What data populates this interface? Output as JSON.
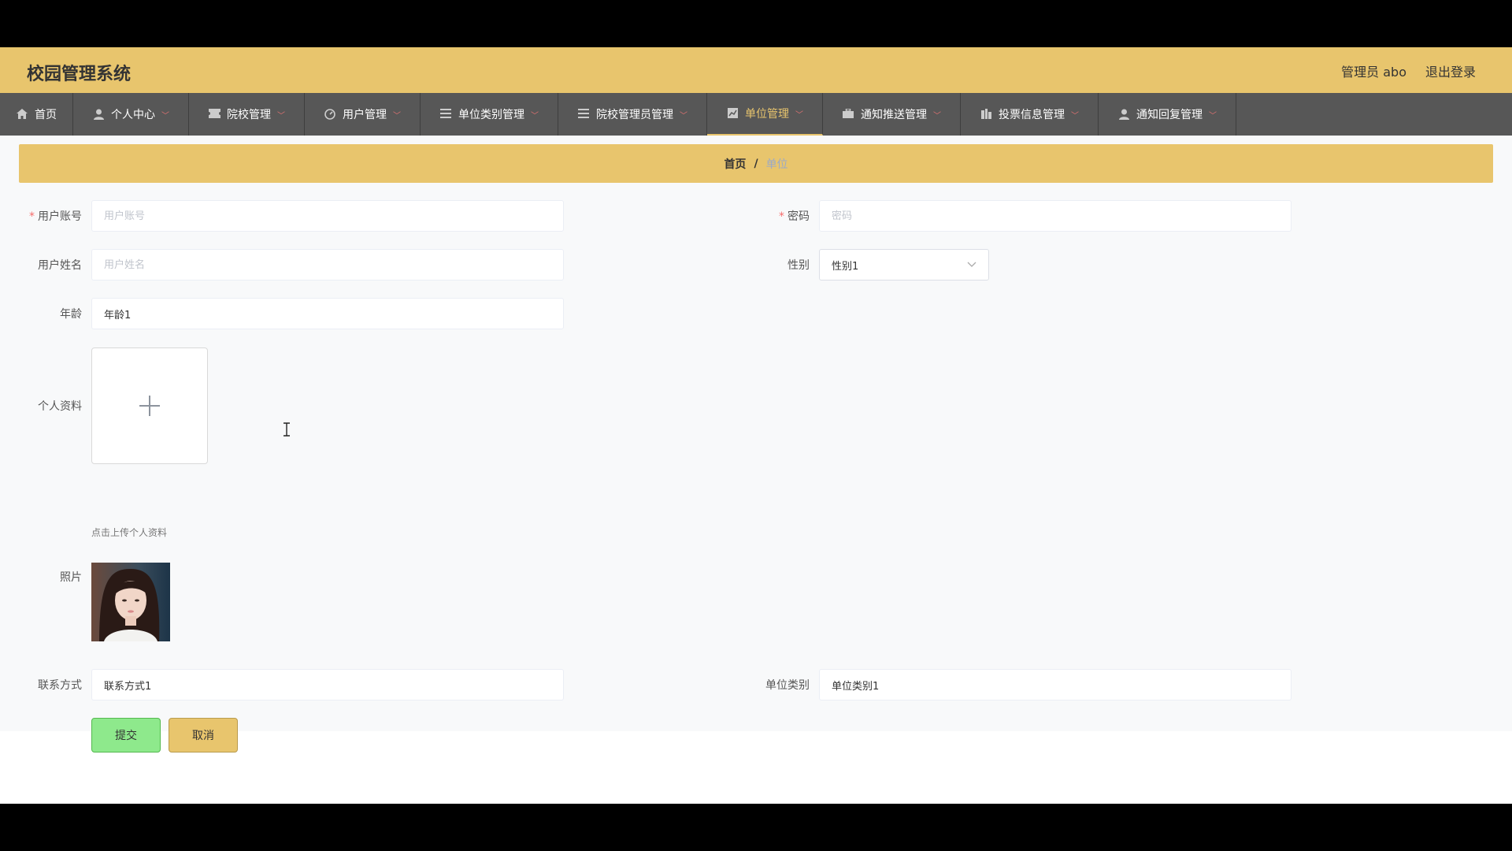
{
  "header": {
    "title": "校园管理系统",
    "admin_label": "管理员 abo",
    "logout_label": "退出登录"
  },
  "nav": {
    "items": [
      {
        "label": "首页",
        "icon": "home-icon"
      },
      {
        "label": "个人中心",
        "icon": "user-icon"
      },
      {
        "label": "院校管理",
        "icon": "ticket-icon"
      },
      {
        "label": "用户管理",
        "icon": "gauge-icon"
      },
      {
        "label": "单位类别管理",
        "icon": "list-icon"
      },
      {
        "label": "院校管理员管理",
        "icon": "list-icon"
      },
      {
        "label": "单位管理",
        "icon": "chart-icon"
      },
      {
        "label": "通知推送管理",
        "icon": "briefcase-icon"
      },
      {
        "label": "投票信息管理",
        "icon": "building-icon"
      },
      {
        "label": "通知回复管理",
        "icon": "user-icon"
      }
    ],
    "active_index": 6
  },
  "breadcrumb": {
    "home": "首页",
    "separator": "/",
    "current": "单位"
  },
  "form": {
    "account": {
      "label": "用户账号",
      "placeholder": "用户账号",
      "value": ""
    },
    "password": {
      "label": "密码",
      "placeholder": "密码",
      "value": ""
    },
    "name": {
      "label": "用户姓名",
      "placeholder": "用户姓名",
      "value": ""
    },
    "gender": {
      "label": "性别",
      "value": "性别1"
    },
    "age": {
      "label": "年龄",
      "value": "年龄1"
    },
    "profile": {
      "label": "个人资料",
      "tip": "点击上传个人资料"
    },
    "photo": {
      "label": "照片"
    },
    "contact": {
      "label": "联系方式",
      "value": "联系方式1"
    },
    "unit_type": {
      "label": "单位类别",
      "value": "单位类别1"
    },
    "submit_label": "提交",
    "cancel_label": "取消"
  },
  "colors": {
    "accent": "#e8c56d",
    "nav_bg": "#575757",
    "submit": "#8ee98c",
    "required": "#f56c6c"
  }
}
